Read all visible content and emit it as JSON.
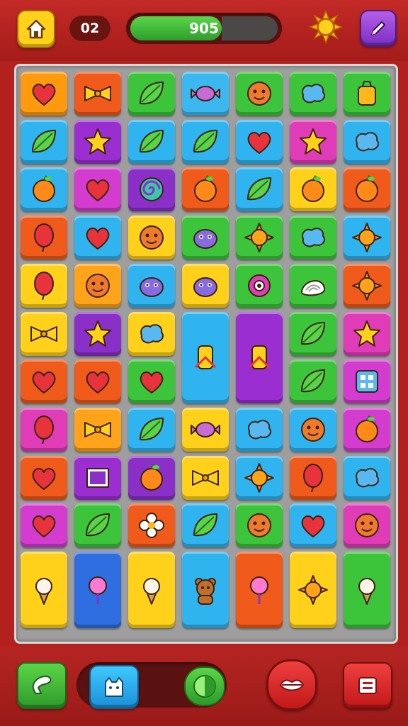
{
  "header": {
    "level_text": "02",
    "score_text": "905",
    "progress": 0.62,
    "icons": {
      "home": "home-icon",
      "sun": "sun-icon",
      "edit": "pencil-icon"
    }
  },
  "board": {
    "rows": [
      [
        [
          "#ff9a0e",
          "heart"
        ],
        [
          "#f05a1a",
          "bow"
        ],
        [
          "#3cc43a",
          "leaf"
        ],
        [
          "#3cb8f0",
          "candy"
        ],
        [
          "#3cc43a",
          "face"
        ],
        [
          "#3cc43a",
          "blob"
        ],
        [
          "#3cc43a",
          "bag"
        ]
      ],
      [
        [
          "#30b4f0",
          "leaf"
        ],
        [
          "#9a2ed0",
          "star"
        ],
        [
          "#30b4f0",
          "leaf"
        ],
        [
          "#30b4f0",
          "leaf"
        ],
        [
          "#30b4f0",
          "heart"
        ],
        [
          "#e03cb8",
          "star"
        ],
        [
          "#30b4f0",
          "blob"
        ]
      ],
      [
        [
          "#30b4f0",
          "fruit"
        ],
        [
          "#d43cd0",
          "heart"
        ],
        [
          "#8a30c8",
          "swirl"
        ],
        [
          "#f05a1a",
          "fruit"
        ],
        [
          "#30b4f0",
          "leaf"
        ],
        [
          "#ffd11a",
          "fruit"
        ],
        [
          "#f05a1a",
          "fruit"
        ]
      ],
      [
        [
          "#f05a1a",
          "balloon"
        ],
        [
          "#30b4f0",
          "heart"
        ],
        [
          "#ffd11a",
          "face"
        ],
        [
          "#3cc43a",
          "creature"
        ],
        [
          "#3cc43a",
          "sun"
        ],
        [
          "#3cc43a",
          "blob"
        ],
        [
          "#30b4f0",
          "sun"
        ]
      ],
      [
        [
          "#ffd11a",
          "balloon"
        ],
        [
          "#ffa31a",
          "face"
        ],
        [
          "#30b4f0",
          "creature"
        ],
        [
          "#ffd11a",
          "creature"
        ],
        [
          "#3cc43a",
          "eye"
        ],
        [
          "#3cc43a",
          "shell"
        ],
        [
          "#f05a1a",
          "sun"
        ]
      ],
      [
        [
          "#ffd11a",
          "bow"
        ],
        [
          "#8a30c8",
          "star"
        ],
        [
          "#ffd11a",
          "blob"
        ],
        [
          "#30b4f0",
          "tall"
        ],
        [
          "#9a2ed0",
          "tall"
        ],
        [
          "#3cc43a",
          "leaf"
        ],
        [
          "#e03cb8",
          "star"
        ]
      ],
      [
        [
          "#f05a1a",
          "heart"
        ],
        [
          "#f05a1a",
          "heart"
        ],
        [
          "#3cc43a",
          "heart"
        ],
        null,
        null,
        [
          "#3cc43a",
          "leaf"
        ],
        [
          "#d43cd0",
          "dice"
        ]
      ],
      [
        [
          "#e03cb8",
          "balloon"
        ],
        [
          "#ffa31a",
          "bow"
        ],
        [
          "#30b4f0",
          "leaf"
        ],
        [
          "#ffd11a",
          "candy"
        ],
        [
          "#30b4f0",
          "blob"
        ],
        [
          "#30b4f0",
          "face"
        ],
        [
          "#d43cd0",
          "fruit"
        ]
      ],
      [
        [
          "#f05a1a",
          "heart"
        ],
        [
          "#9a2ed0",
          "frame"
        ],
        [
          "#8a30c8",
          "fruit"
        ],
        [
          "#ffd11a",
          "bow"
        ],
        [
          "#30b4f0",
          "sun"
        ],
        [
          "#f05a1a",
          "balloon"
        ],
        [
          "#30b4f0",
          "blob"
        ]
      ],
      [
        [
          "#d43cd0",
          "heart"
        ],
        [
          "#3cc43a",
          "leaf"
        ],
        [
          "#f05a1a",
          "flower"
        ],
        [
          "#30b4f0",
          "leaf"
        ],
        [
          "#3cc43a",
          "face"
        ],
        [
          "#30b4f0",
          "heart"
        ],
        [
          "#e03cb8",
          "face"
        ]
      ],
      [
        [
          "#ffd11a",
          "icecream"
        ],
        [
          "#2f6ee0",
          "cotton"
        ],
        [
          "#ffd11a",
          "icecream"
        ],
        [
          "#30b4f0",
          "bear"
        ],
        [
          "#f05a1a",
          "cotton"
        ],
        [
          "#ffd11a",
          "sun"
        ],
        [
          "#3cc43a",
          "icecream"
        ]
      ]
    ]
  },
  "footer": {
    "icons": {
      "trophy": "trophy-icon",
      "booster": "cat-icon",
      "toggle": "toggle-icon",
      "lips": "lips-icon",
      "menu": "menu-icon"
    }
  }
}
